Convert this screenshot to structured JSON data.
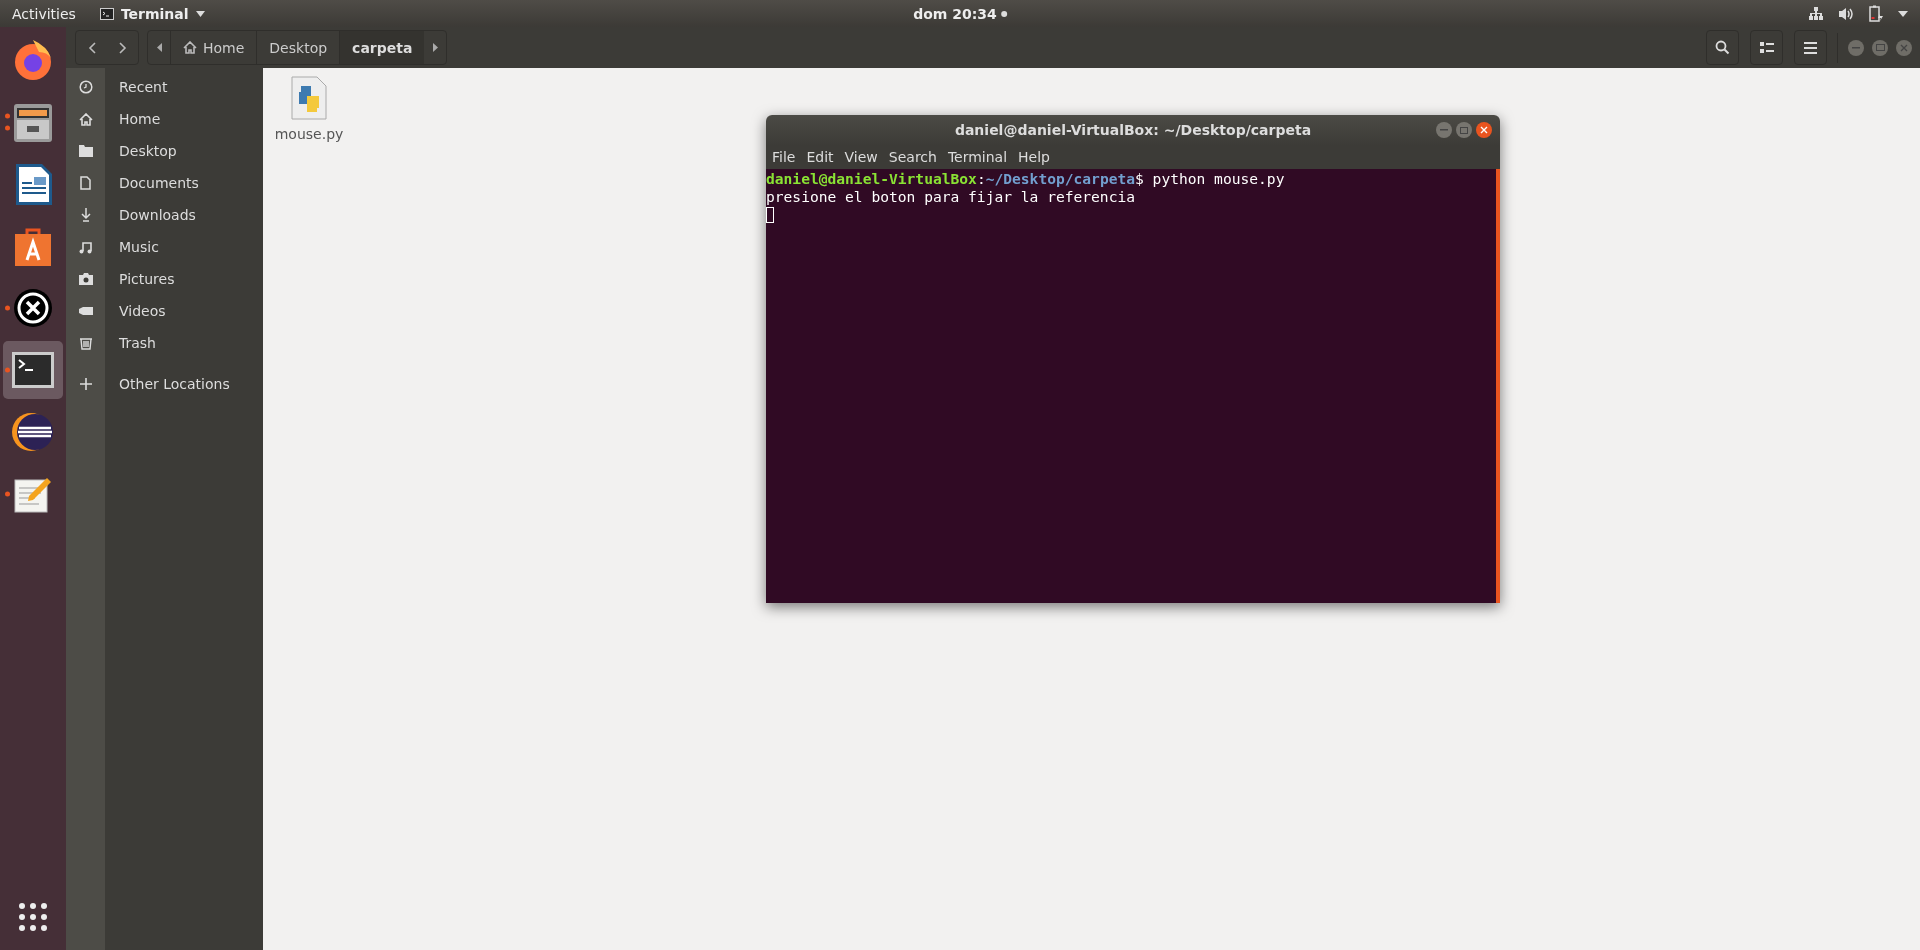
{
  "top_bar": {
    "activities": "Activities",
    "app_menu": "Terminal",
    "clock": "dom 20:34",
    "notification_dot": true
  },
  "dock": [
    {
      "kind": "firefox",
      "running": false,
      "multiple_windows": false,
      "selected": false
    },
    {
      "kind": "files",
      "running": true,
      "multiple_windows": true,
      "selected": false
    },
    {
      "kind": "writer",
      "running": false,
      "multiple_windows": false,
      "selected": false
    },
    {
      "kind": "software",
      "running": false,
      "multiple_windows": false,
      "selected": false
    },
    {
      "kind": "xkill",
      "running": true,
      "multiple_windows": false,
      "selected": false
    },
    {
      "kind": "terminal",
      "running": true,
      "multiple_windows": false,
      "selected": true
    },
    {
      "kind": "eclipse",
      "running": false,
      "multiple_windows": false,
      "selected": false
    },
    {
      "kind": "editor",
      "running": true,
      "multiple_windows": false,
      "selected": false
    }
  ],
  "file_manager": {
    "breadcrumbs": [
      {
        "label": "Home",
        "kind": "home",
        "selected": false
      },
      {
        "label": "Desktop",
        "kind": "folder",
        "selected": false
      },
      {
        "label": "carpeta",
        "kind": "folder",
        "selected": true
      }
    ],
    "sidebar": [
      {
        "label": "Recent",
        "kind": "recent"
      },
      {
        "label": "Home",
        "kind": "home"
      },
      {
        "label": "Desktop",
        "kind": "desktop"
      },
      {
        "label": "Documents",
        "kind": "documents"
      },
      {
        "label": "Downloads",
        "kind": "downloads"
      },
      {
        "label": "Music",
        "kind": "music"
      },
      {
        "label": "Pictures",
        "kind": "pictures"
      },
      {
        "label": "Videos",
        "kind": "videos"
      },
      {
        "label": "Trash",
        "kind": "trash"
      },
      {
        "label": "Other Locations",
        "kind": "other"
      }
    ],
    "files": [
      {
        "name": "mouse.py",
        "kind": "python"
      }
    ]
  },
  "terminal": {
    "title": "daniel@daniel-VirtualBox: ~/Desktop/carpeta",
    "menu": [
      "File",
      "Edit",
      "View",
      "Search",
      "Terminal",
      "Help"
    ],
    "prompt_user": "daniel@daniel-VirtualBox",
    "prompt_sep": ":",
    "prompt_path": "~/Desktop/carpeta",
    "command": "$ python mouse.py",
    "output": [
      "presione el boton para fijar la referencia"
    ]
  }
}
